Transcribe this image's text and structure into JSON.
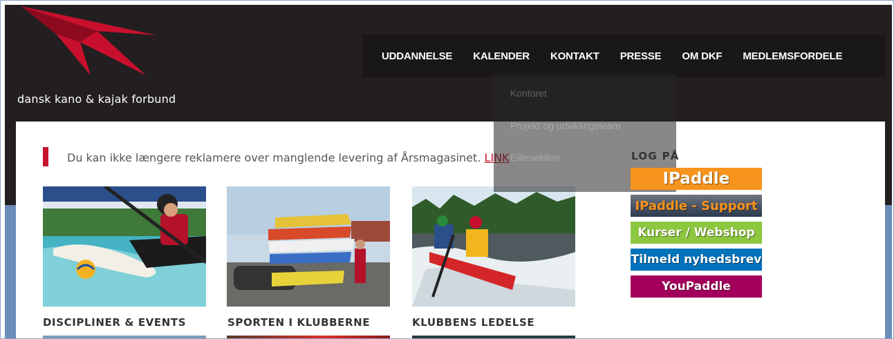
{
  "brand": {
    "name": "dansk kano & kajak forbund"
  },
  "nav": {
    "items": [
      "UDDANNELSE",
      "KALENDER",
      "KONTAKT",
      "PRESSE",
      "OM DKF",
      "MEDLEMSFORDELE"
    ],
    "dropdown": [
      "Kontoret",
      "Projekt og udviklingsteam",
      "Elitesektion"
    ]
  },
  "notice": {
    "text": "Du kan ikke længere reklamere over manglende levering af Årsmagasinet. ",
    "link": "LINK"
  },
  "tiles": [
    {
      "title": "DISCIPLINER & EVENTS"
    },
    {
      "title": "SPORTEN I KLUBBERNE"
    },
    {
      "title": "KLUBBENS LEDELSE"
    }
  ],
  "login": {
    "title": "LOG PÅ",
    "buttons": [
      {
        "label": "IPaddle",
        "color": "#f7941d"
      },
      {
        "label": "IPaddle - Support",
        "color": "#f7941d"
      },
      {
        "label": "Kurser / Webshop",
        "color": "#8dc63f"
      },
      {
        "label": "Tilmeld nyhedsbrev",
        "color": "#0072bc"
      },
      {
        "label": "YouPaddle",
        "color": "#a3005c"
      }
    ]
  },
  "colors": {
    "header_bg": "#231f20",
    "accent_red": "#c8102e",
    "band_blue": "#6b8db8"
  }
}
